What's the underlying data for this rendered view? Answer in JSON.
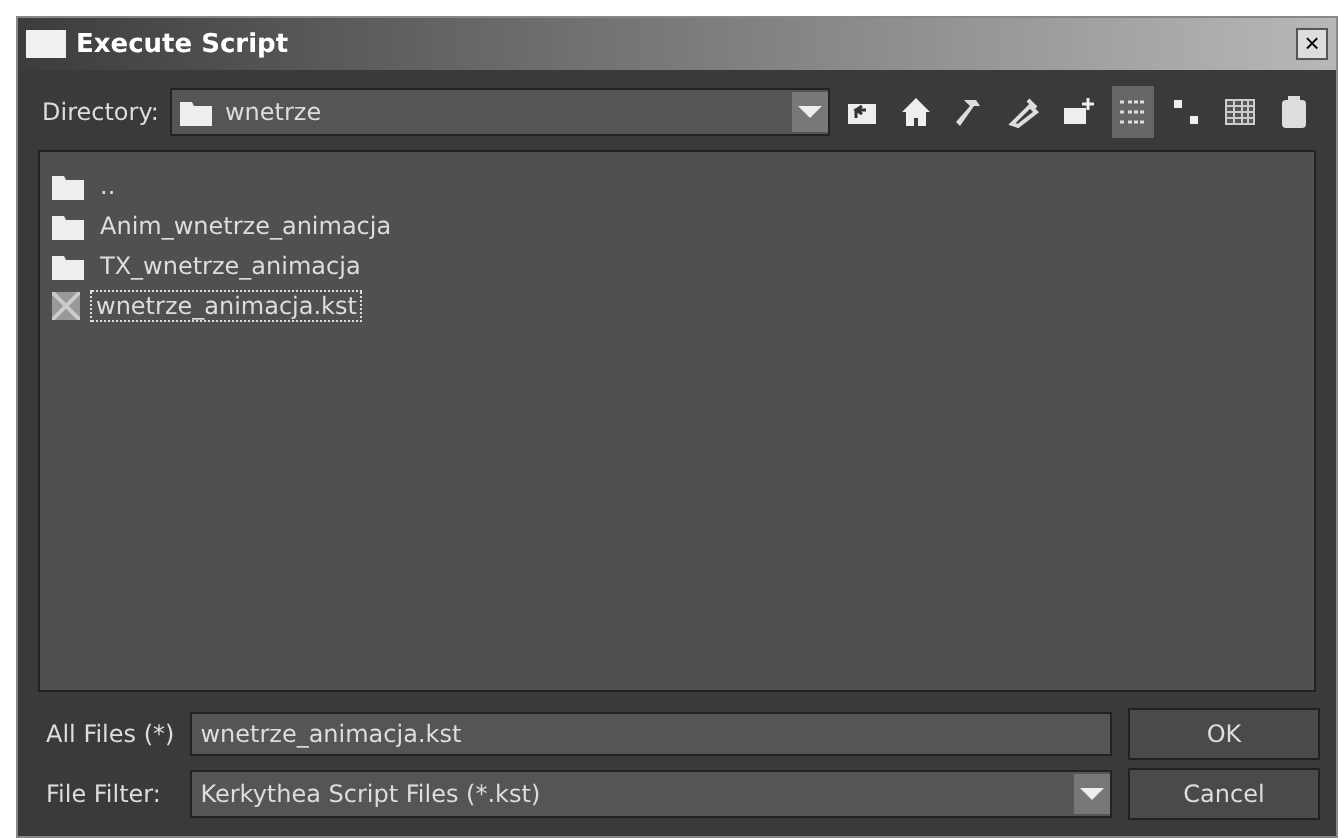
{
  "window": {
    "title": "Execute Script",
    "close": "×"
  },
  "directory": {
    "label": "Directory:",
    "value": "wnetrze"
  },
  "toolbar": [
    {
      "kind": "up",
      "selected": false
    },
    {
      "kind": "home",
      "selected": false
    },
    {
      "kind": "hammer",
      "selected": false
    },
    {
      "kind": "tool",
      "selected": false
    },
    {
      "kind": "newfolder",
      "selected": false
    },
    {
      "kind": "list",
      "selected": true
    },
    {
      "kind": "details",
      "selected": false
    },
    {
      "kind": "grid",
      "selected": false
    },
    {
      "kind": "clipboard",
      "selected": false
    }
  ],
  "files": [
    {
      "kind": "folder",
      "name": "..",
      "selected": false
    },
    {
      "kind": "folder",
      "name": "Anim_wnetrze_animacja",
      "selected": false
    },
    {
      "kind": "folder",
      "name": "TX_wnetrze_animacja",
      "selected": false
    },
    {
      "kind": "script",
      "name": "wnetrze_animacja.kst",
      "selected": true
    }
  ],
  "file_name": {
    "label": "All Files (*)",
    "value": "wnetrze_animacja.kst"
  },
  "file_filter": {
    "label": "File Filter:",
    "value": "Kerkythea Script Files (*.kst)"
  },
  "buttons": [
    "OK",
    "Cancel"
  ]
}
